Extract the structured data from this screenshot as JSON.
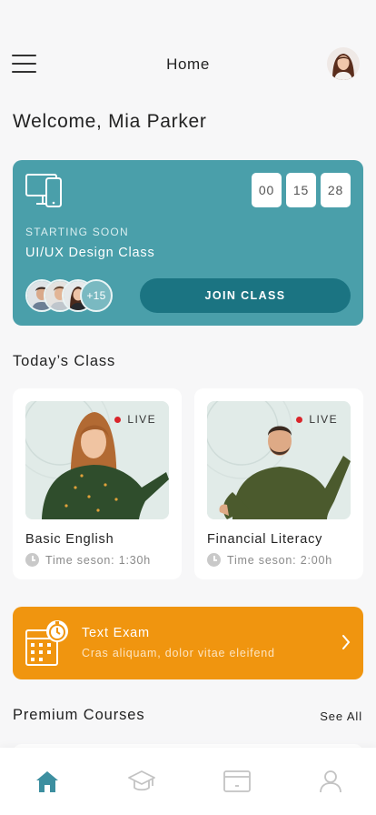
{
  "header": {
    "title": "Home"
  },
  "welcome": "Welcome, Mia Parker",
  "hero": {
    "eyebrow": "STARTING SOON",
    "title": "UI/UX Design Class",
    "countdown": [
      "00",
      "15",
      "28"
    ],
    "extra_attendees": "+15",
    "join_label": "JOIN CLASS",
    "icon": "devices-icon",
    "color": "#4a9faa"
  },
  "todays_class": {
    "title": "Today’s Class",
    "cards": [
      {
        "name": "Basic English",
        "live": "LIVE",
        "time": "Time seson: 1:30h"
      },
      {
        "name": "Financial Literacy",
        "live": "LIVE",
        "time": "Time seson: 2:00h"
      }
    ]
  },
  "exam": {
    "title": "Text Exam",
    "subtitle": "Cras aliquam, dolor vitae eleifend",
    "icon": "exam-calendar-icon",
    "color": "#f0950f"
  },
  "premium": {
    "title": "Premium Courses",
    "see_all": "See All"
  },
  "tabbar": {
    "items": [
      "home-icon",
      "graduation-cap-icon",
      "payment-card-icon",
      "profile-icon"
    ],
    "active_color": "#3d8fa0"
  }
}
